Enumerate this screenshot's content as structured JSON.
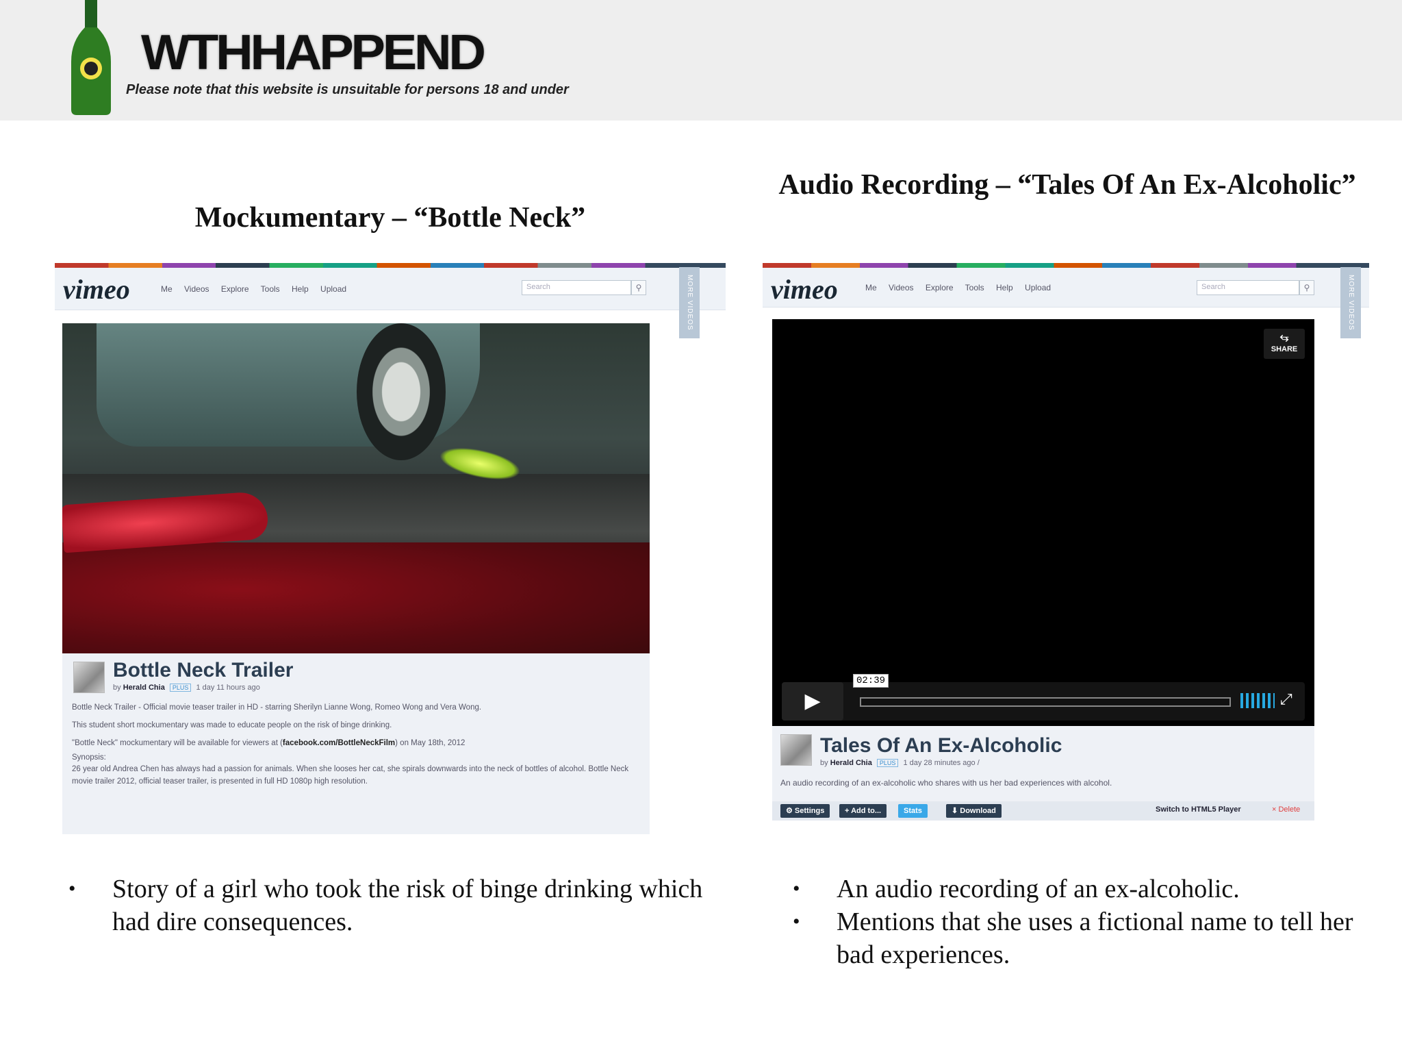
{
  "banner": {
    "title": "WTHHAPPEND",
    "note": "Please note that this website is unsuitable for persons 18 and under"
  },
  "left_section": {
    "title": "Mockumentary – “Bottle Neck”",
    "vimeo": {
      "logo": "vimeo",
      "nav": [
        "Me",
        "Videos",
        "Explore",
        "Tools",
        "Help",
        "Upload"
      ],
      "search_placeholder": "Search",
      "more_videos": "MORE VIDEOS",
      "video_title": "Bottle Neck Trailer",
      "by": "by",
      "author": "Herald Chia",
      "plus": "PLUS",
      "posted": "1 day 11 hours ago",
      "desc_line1": "Bottle Neck Trailer - Official movie teaser trailer in HD - starring Sherilyn Lianne Wong, Romeo Wong and Vera Wong.",
      "desc_line2": "This student short mockumentary was made to educate people on the risk of binge drinking.",
      "desc_line3_pre": "\"Bottle Neck\" mockumentary will be available for viewers at (",
      "desc_line3_link": "facebook.com/BottleNeckFilm",
      "desc_line3_post": ") on May 18th, 2012",
      "synopsis_label": "Synopsis:",
      "synopsis": "26 year old Andrea Chen has always had a passion for animals. When she looses her cat, she spirals downwards into the neck of bottles of alcohol. Bottle Neck movie trailer 2012, official teaser trailer, is presented in full HD 1080p high resolution."
    },
    "bullets": [
      "Story of a girl who took the risk of binge drinking which had dire consequences."
    ]
  },
  "right_section": {
    "title": "Audio Recording – “Tales Of An Ex-Alcoholic”",
    "vimeo": {
      "logo": "vimeo",
      "nav": [
        "Me",
        "Videos",
        "Explore",
        "Tools",
        "Help",
        "Upload"
      ],
      "search_placeholder": "Search",
      "more_videos": "MORE VIDEOS",
      "share": "SHARE",
      "timecode": "02:39",
      "video_title": "Tales Of An Ex-Alcoholic",
      "by": "by",
      "author": "Herald Chia",
      "plus": "PLUS",
      "posted": "1 day 28 minutes ago /",
      "desc": "An audio recording of an ex-alcoholic who shares with us her bad experiences with alcohol.",
      "buttons": {
        "settings": "⚙ Settings",
        "add_to": "+ Add to...",
        "stats": "Stats",
        "download": "⬇ Download",
        "switch": "Switch to HTML5 Player",
        "delete": "× Delete"
      }
    },
    "bullets": [
      "An audio recording of an ex-alcoholic.",
      "Mentions that she uses a fictional name to tell her bad experiences."
    ]
  }
}
